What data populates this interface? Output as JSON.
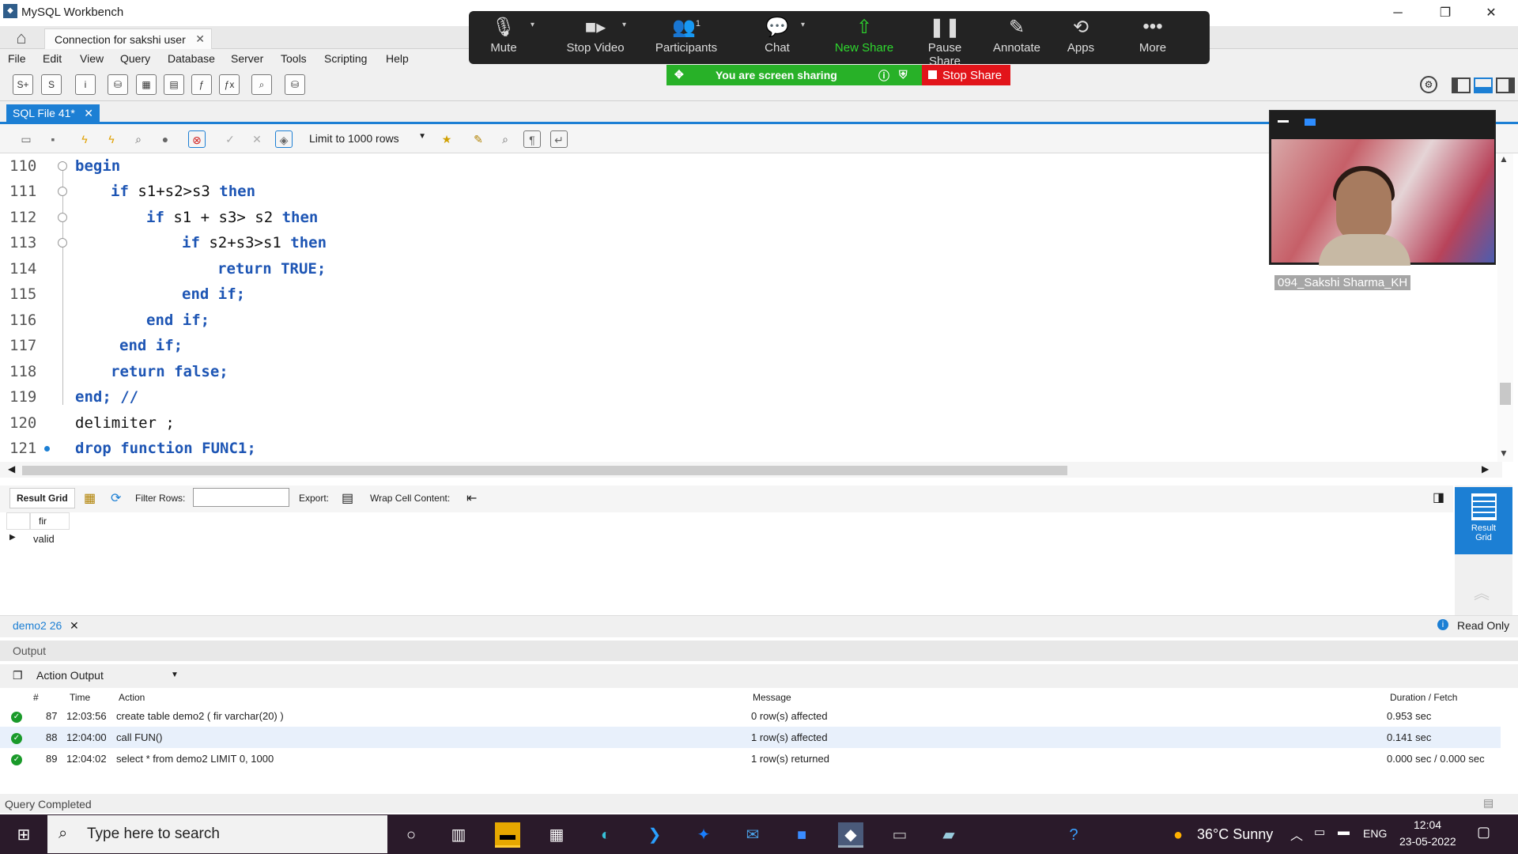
{
  "window": {
    "title": "MySQL Workbench"
  },
  "connection_tab": {
    "label": "Connection for sakshi user"
  },
  "menu": [
    "File",
    "Edit",
    "View",
    "Query",
    "Database",
    "Server",
    "Tools",
    "Scripting",
    "Help"
  ],
  "sql_tab": {
    "label": "SQL File 41*"
  },
  "editor_toolbar": {
    "limit_label": "Limit to 1000 rows"
  },
  "code_lines": [
    {
      "num": "110",
      "text": "begin"
    },
    {
      "num": "111",
      "text": "if s1+s2>s3 then"
    },
    {
      "num": "112",
      "text": "if s1 + s3> s2 then"
    },
    {
      "num": "113",
      "text": "if s2+s3>s1 then"
    },
    {
      "num": "114",
      "text": "return TRUE;"
    },
    {
      "num": "115",
      "text": "end if;"
    },
    {
      "num": "116",
      "text": "end if;"
    },
    {
      "num": "117",
      "text": "end if;"
    },
    {
      "num": "118",
      "text": "return false;"
    },
    {
      "num": "119",
      "text": "end; //"
    },
    {
      "num": "120",
      "text": "delimiter ;"
    },
    {
      "num": "121",
      "text": "drop function FUNC1;"
    }
  ],
  "result_toolbar": {
    "result_grid": "Result Grid",
    "filter_rows": "Filter Rows:",
    "export": "Export:",
    "wrap": "Wrap Cell Content:"
  },
  "grid": {
    "column": "fir",
    "rows": [
      "valid"
    ]
  },
  "side_panel": {
    "result_grid_label": "Result Grid"
  },
  "result_tab": {
    "label": "demo2 26",
    "read_only": "Read Only"
  },
  "output": {
    "title": "Output",
    "selector": "Action Output",
    "headers": {
      "num": "#",
      "time": "Time",
      "action": "Action",
      "message": "Message",
      "duration": "Duration / Fetch"
    },
    "rows": [
      {
        "num": "87",
        "time": "12:03:56",
        "action": "create table demo2 ( fir varchar(20) )",
        "message": "0 row(s) affected",
        "duration": "0.953 sec"
      },
      {
        "num": "88",
        "time": "12:04:00",
        "action": "call FUN()",
        "message": "1 row(s) affected",
        "duration": "0.141 sec"
      },
      {
        "num": "89",
        "time": "12:04:02",
        "action": "select * from demo2 LIMIT 0, 1000",
        "message": "1 row(s) returned",
        "duration": "0.000 sec / 0.000 sec"
      }
    ]
  },
  "status": {
    "text": "Query Completed"
  },
  "zoom": {
    "mute": "Mute",
    "stop_video": "Stop Video",
    "participants": "Participants",
    "participants_count": "1",
    "chat": "Chat",
    "new_share": "New Share",
    "pause_share": "Pause Share",
    "annotate": "Annotate",
    "apps": "Apps",
    "more": "More",
    "banner": "You are screen sharing",
    "stop_share": "Stop Share",
    "participant_name": "094_Sakshi Sharma_KH"
  },
  "taskbar": {
    "search_placeholder": "Type here to search",
    "weather": "36°C  Sunny",
    "lang": "ENG",
    "time": "12:04",
    "date": "23-05-2022"
  }
}
